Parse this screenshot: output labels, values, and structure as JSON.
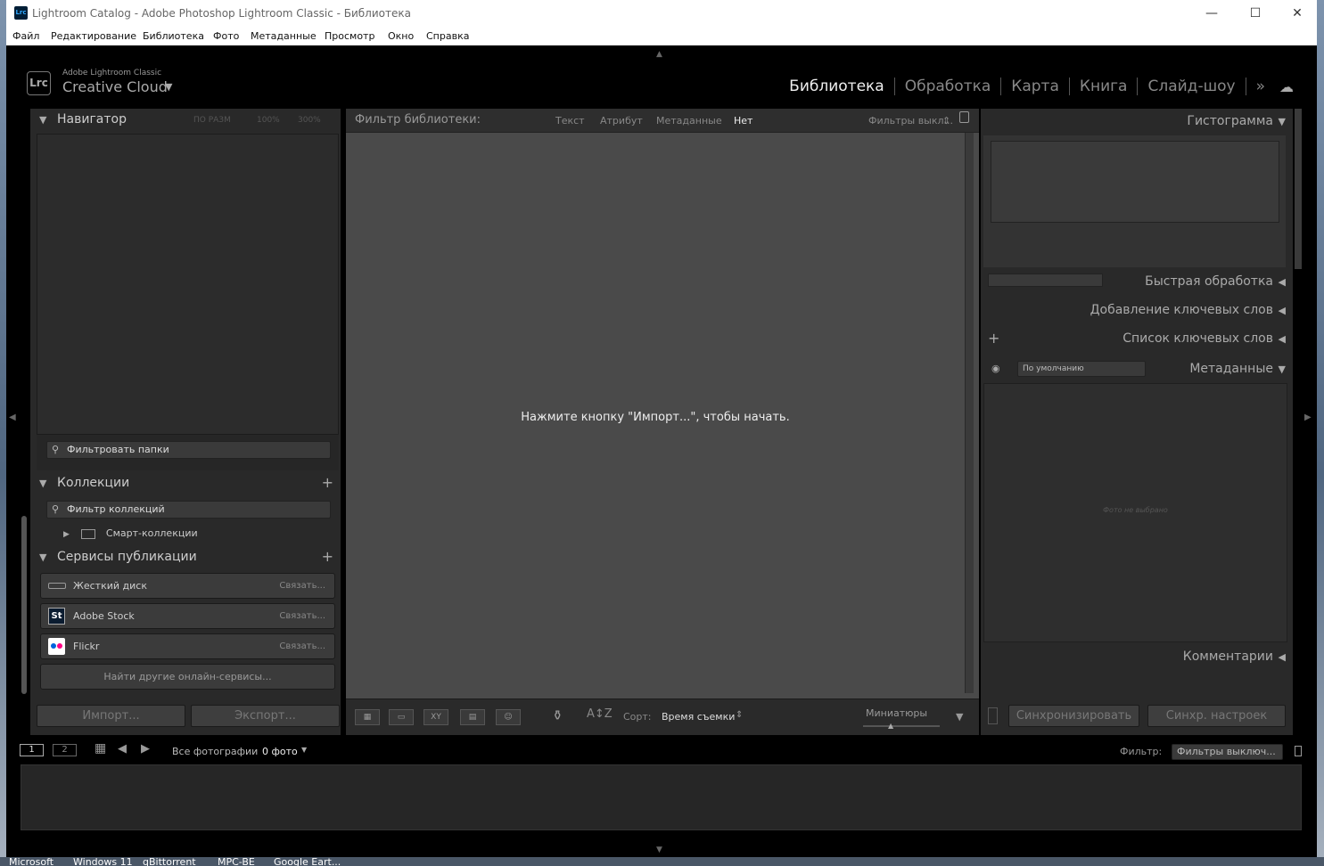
{
  "window": {
    "title": "Lightroom Catalog - Adobe Photoshop Lightroom Classic - Библиотека",
    "minimize": "—",
    "maximize": "☐",
    "close": "✕",
    "app_icon": "Lrc"
  },
  "menu": [
    "Файл",
    "Редактирование",
    "Библиотека",
    "Фото",
    "Метаданные",
    "Просмотр",
    "Окно",
    "Справка"
  ],
  "identity": {
    "logo": "Lrc",
    "line1": "Adobe Lightroom Classic",
    "line2": "Creative Cloud",
    "caret": "▼"
  },
  "modules": {
    "items": [
      "Библиотека",
      "Обработка",
      "Карта",
      "Книга",
      "Слайд-шоу"
    ],
    "more": "»",
    "active": "Библиотека"
  },
  "navigator": {
    "title": "Навигатор",
    "zoom": [
      "ПО РАЗМ",
      "100%",
      "300%"
    ]
  },
  "folders": {
    "filter_placeholder": "Фильтровать папки"
  },
  "collections": {
    "title": "Коллекции",
    "filter": "Фильтр коллекций",
    "smart": "Смарт-коллекции"
  },
  "publish": {
    "title": "Сервисы публикации",
    "services": [
      {
        "name": "Жесткий диск",
        "action": "Связать..."
      },
      {
        "name": "Adobe Stock",
        "action": "Связать...",
        "badge": "St"
      },
      {
        "name": "Flickr",
        "action": "Связать..."
      }
    ],
    "find_more": "Найти другие онлайн-сервисы..."
  },
  "left_buttons": {
    "import": "Импорт...",
    "export": "Экспорт..."
  },
  "library_filter": {
    "label": "Фильтр библиотеки:",
    "options": [
      "Текст",
      "Атрибут",
      "Метаданные",
      "Нет"
    ],
    "preset": "Фильтры выкл..."
  },
  "grid": {
    "empty_message": "Нажмите кнопку \"Импорт...\", чтобы начать."
  },
  "right": {
    "histogram": "Гистограмма",
    "quick_develop": "Быстрая обработка",
    "keywording": "Добавление ключевых слов",
    "keyword_list": "Список ключевых слов",
    "metadata": "Метаданные",
    "metadata_preset": "По умолчанию",
    "no_photo": "Фото не выбрано",
    "comments": "Комментарии",
    "sync": "Синхронизировать",
    "sync_settings": "Синхр. настроек"
  },
  "toolbar": {
    "sort_label": "Сорт:",
    "sort_value": "Время съемки",
    "thumbs_label": "Миниатюры"
  },
  "filmstrip": {
    "page1": "1",
    "page2": "2",
    "source": "Все фотографии",
    "count": "0 фото",
    "filter_label": "Фильтр:",
    "filter_value": "Фильтры выключ..."
  },
  "taskbar": [
    "Microsoft",
    "Windows 11",
    "qBittorrent",
    "MPC-BE",
    "Google Eart..."
  ]
}
